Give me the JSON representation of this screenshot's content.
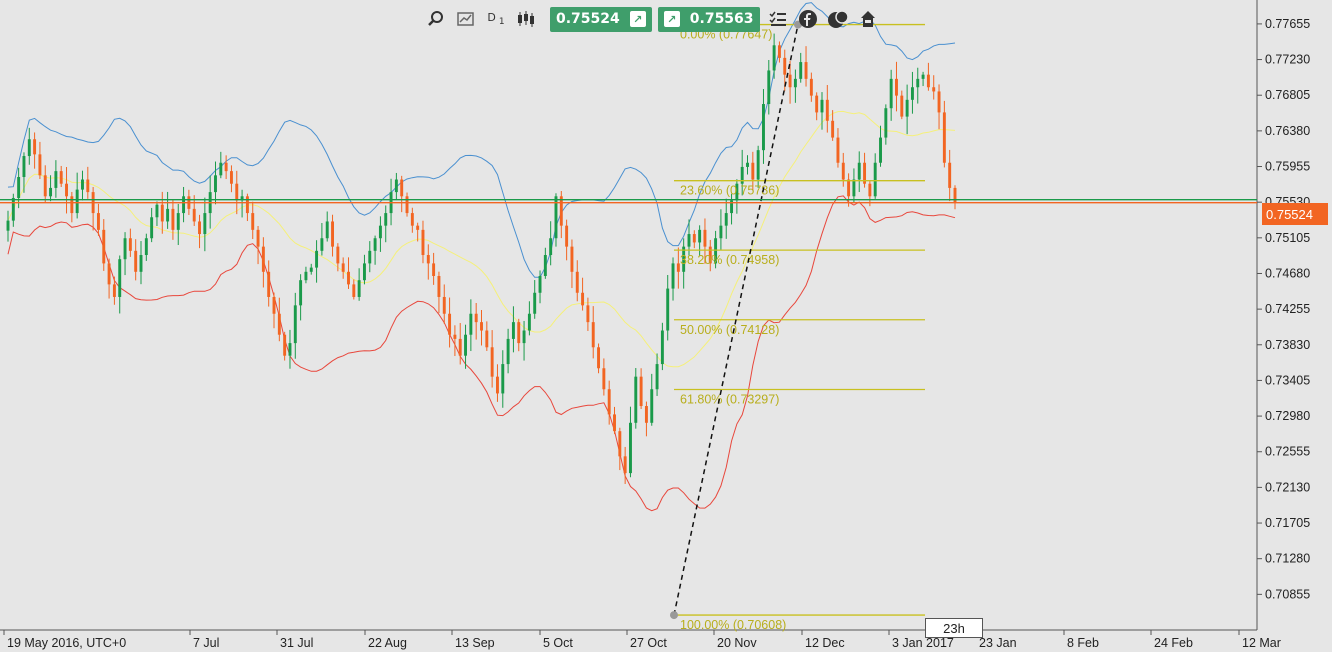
{
  "toolbar": {
    "timeframe": "D",
    "timeframe_count": "1",
    "sell_price": "0.75524",
    "buy_price": "0.75563",
    "icons": [
      "zoom-icon",
      "chart-settings-icon",
      "timeframe-icon",
      "candles-icon",
      "sell-arrow-icon",
      "buy-arrow-icon",
      "list-icon",
      "facebook-icon",
      "news-icon",
      "trader-icon"
    ]
  },
  "current_price_label": "0.75524",
  "countdown_label": "23h",
  "colors": {
    "bull": "#1a9a4a",
    "bear": "#f26522",
    "upper_band": "#4a90d0",
    "middle_band": "#f5f07a",
    "lower_band": "#e8473c",
    "fib": "#c8c020",
    "price_line_green": "#1a9a4a",
    "price_line_red": "#f26522"
  },
  "chart_data": {
    "type": "candlestick",
    "instrument_timeframe": "D1",
    "ylim": [
      0.7043,
      0.7794
    ],
    "y_ticks": [
      "0.77655",
      "0.77230",
      "0.76805",
      "0.76380",
      "0.75955",
      "0.75530",
      "0.75105",
      "0.74680",
      "0.74255",
      "0.73830",
      "0.73405",
      "0.72980",
      "0.72555",
      "0.72130",
      "0.71705",
      "0.71280",
      "0.70855"
    ],
    "x_ticks": [
      "19 May 2016, UTC+0",
      "7 Jul",
      "31 Jul",
      "22 Aug",
      "13 Sep",
      "5 Oct",
      "27 Oct",
      "20 Nov",
      "12 Dec",
      "3 Jan 2017",
      "23 Jan",
      "8 Feb",
      "24 Feb",
      "12 Mar"
    ],
    "current_price": 0.75524,
    "fibonacci": [
      {
        "label": "0.00% (0.77647)",
        "value": 0.77647
      },
      {
        "label": "23.60% (0.75786)",
        "value": 0.75786
      },
      {
        "label": "38.20% (0.74958)",
        "value": 0.74958
      },
      {
        "label": "50.00% (0.74128)",
        "value": 0.74128
      },
      {
        "label": "61.80% (0.73297)",
        "value": 0.73297
      },
      {
        "label": "100.00% (0.70608)",
        "value": 0.70608
      }
    ],
    "candles_close": [
      0.7531,
      0.7558,
      0.7583,
      0.7608,
      0.7628,
      0.761,
      0.7585,
      0.756,
      0.757,
      0.759,
      0.7575,
      0.756,
      0.754,
      0.7568,
      0.758,
      0.7565,
      0.754,
      0.752,
      0.748,
      0.7455,
      0.744,
      0.7485,
      0.751,
      0.7495,
      0.747,
      0.749,
      0.751,
      0.7535,
      0.755,
      0.753,
      0.7545,
      0.752,
      0.754,
      0.756,
      0.7545,
      0.753,
      0.7515,
      0.754,
      0.7565,
      0.7585,
      0.76,
      0.759,
      0.7575,
      0.7555,
      0.756,
      0.754,
      0.752,
      0.75,
      0.747,
      0.744,
      0.742,
      0.7395,
      0.737,
      0.7385,
      0.743,
      0.746,
      0.747,
      0.7475,
      0.7495,
      0.751,
      0.753,
      0.75,
      0.748,
      0.747,
      0.7455,
      0.744,
      0.746,
      0.748,
      0.7495,
      0.751,
      0.7525,
      0.754,
      0.7565,
      0.758,
      0.756,
      0.754,
      0.7525,
      0.752,
      0.749,
      0.748,
      0.7465,
      0.744,
      0.742,
      0.7395,
      0.739,
      0.737,
      0.7395,
      0.742,
      0.741,
      0.74,
      0.738,
      0.7345,
      0.7325,
      0.736,
      0.739,
      0.741,
      0.7385,
      0.74,
      0.742,
      0.7445,
      0.7465,
      0.749,
      0.751,
      0.756,
      0.7525,
      0.75,
      0.747,
      0.7445,
      0.743,
      0.741,
      0.738,
      0.7355,
      0.733,
      0.73,
      0.728,
      0.725,
      0.723,
      0.729,
      0.7345,
      0.731,
      0.729,
      0.733,
      0.736,
      0.74,
      0.745,
      0.748,
      0.747,
      0.75,
      0.7515,
      0.7505,
      0.752,
      0.75,
      0.748,
      0.751,
      0.7525,
      0.754,
      0.7555,
      0.7575,
      0.7595,
      0.76,
      0.758,
      0.7615,
      0.767,
      0.771,
      0.774,
      0.7725,
      0.7705,
      0.769,
      0.77,
      0.772,
      0.77,
      0.768,
      0.766,
      0.7675,
      0.765,
      0.763,
      0.76,
      0.758,
      0.756,
      0.758,
      0.76,
      0.7575,
      0.756,
      0.76,
      0.763,
      0.7665,
      0.77,
      0.768,
      0.7655,
      0.7675,
      0.769,
      0.77,
      0.7705,
      0.769,
      0.7685,
      0.766,
      0.76,
      0.757,
      0.7552
    ]
  }
}
